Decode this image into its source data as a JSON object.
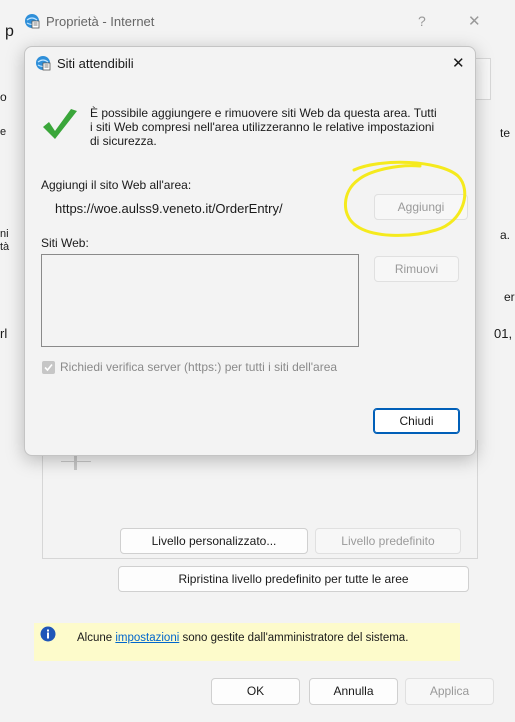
{
  "outer_window": {
    "title": "Proprietà - Internet",
    "help_glyph": "?",
    "close_glyph": "✕",
    "left_fragments": [
      "p",
      "o",
      "e",
      "ni",
      "tà",
      "rl"
    ],
    "right_fragments": [
      "te",
      "a.",
      "er",
      "01,"
    ]
  },
  "main_panel": {
    "custom_level_label": "Livello personalizzato...",
    "default_level_label": "Livello predefinito",
    "reset_all_label": "Ripristina livello predefinito per tutte le aree",
    "info_prefix": "Alcune ",
    "info_link": "impostazioni",
    "info_suffix": " sono gestite dall'amministratore del sistema."
  },
  "footer": {
    "ok_label": "OK",
    "cancel_label": "Annulla",
    "apply_label": "Applica"
  },
  "dialog": {
    "title": "Siti attendibili",
    "close_glyph": "✕",
    "description": "È possibile aggiungere e rimuovere siti Web da questa area. Tutti i siti Web compresi nell'area utilizzeranno le relative impostazioni di sicurezza.",
    "add_label": "Aggiungi il sito Web all'area:",
    "url_value": "https://woe.aulss9.veneto.it/OrderEntry/",
    "add_button": "Aggiungi",
    "sites_label": "Siti Web:",
    "remove_button": "Rimuovi",
    "https_checkbox_label": "Richiedi verifica server (https:) per tutti i siti dell'area",
    "close_button": "Chiudi"
  },
  "colors": {
    "highlight_circle": "#f5ea1d",
    "checkmark": "#3aa63a",
    "info_bg": "#fdfbcb",
    "link": "#0066cc"
  }
}
